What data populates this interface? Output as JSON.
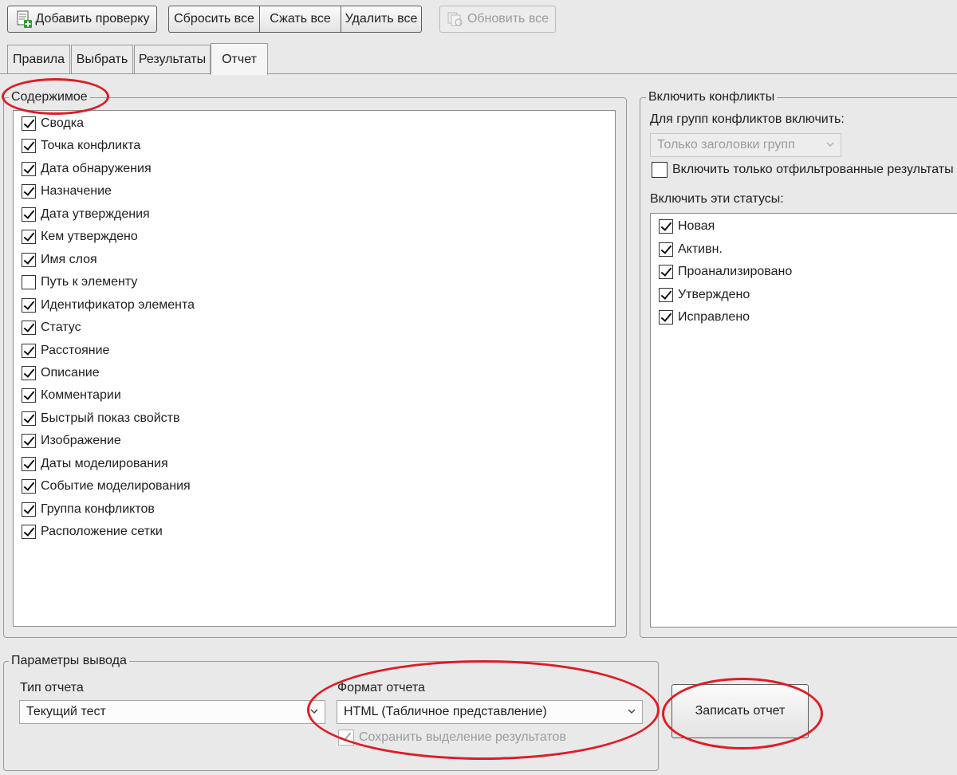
{
  "toolbar": {
    "add_check": "Добавить проверку",
    "reset_all": "Сбросить все",
    "compact_all": "Сжать все",
    "delete_all": "Удалить все",
    "update_all": "Обновить все"
  },
  "tabs": [
    {
      "label": "Правила"
    },
    {
      "label": "Выбрать"
    },
    {
      "label": "Результаты"
    },
    {
      "label": "Отчет",
      "active": true
    }
  ],
  "contents": {
    "title": "Содержимое",
    "items": [
      {
        "label": "Сводка",
        "checked": true
      },
      {
        "label": "Точка конфликта",
        "checked": true
      },
      {
        "label": "Дата обнаружения",
        "checked": true
      },
      {
        "label": "Назначение",
        "checked": true
      },
      {
        "label": "Дата утверждения",
        "checked": true
      },
      {
        "label": "Кем утверждено",
        "checked": true
      },
      {
        "label": "Имя слоя",
        "checked": true
      },
      {
        "label": "Путь к элементу",
        "checked": false
      },
      {
        "label": "Идентификатор элемента",
        "checked": true
      },
      {
        "label": "Статус",
        "checked": true
      },
      {
        "label": "Расстояние",
        "checked": true
      },
      {
        "label": "Описание",
        "checked": true
      },
      {
        "label": "Комментарии",
        "checked": true
      },
      {
        "label": "Быстрый показ свойств",
        "checked": true
      },
      {
        "label": "Изображение",
        "checked": true
      },
      {
        "label": "Даты моделирования",
        "checked": true
      },
      {
        "label": "Событие моделирования",
        "checked": true
      },
      {
        "label": "Группа конфликтов",
        "checked": true
      },
      {
        "label": "Расположение сетки",
        "checked": true
      }
    ]
  },
  "conflicts": {
    "title": "Включить конфликты",
    "groups_label": "Для групп конфликтов включить:",
    "groups_value": "Только заголовки групп",
    "filtered_only_label": "Включить только отфильтрованные результаты",
    "filtered_only_checked": false,
    "statuses_label": "Включить эти статусы:",
    "statuses": [
      {
        "label": "Новая",
        "checked": true
      },
      {
        "label": "Активн.",
        "checked": true
      },
      {
        "label": "Проанализировано",
        "checked": true
      },
      {
        "label": "Утверждено",
        "checked": true
      },
      {
        "label": "Исправлено",
        "checked": true
      }
    ]
  },
  "output": {
    "title": "Параметры вывода",
    "report_type_label": "Тип отчета",
    "report_type_value": "Текущий тест",
    "report_format_label": "Формат отчета",
    "report_format_value": "HTML (Табличное представление)",
    "keep_selection_label": "Сохранить выделение результатов",
    "keep_selection_checked": true,
    "write_report": "Записать отчет"
  },
  "colors": {
    "annotation": "#e01b24",
    "window_bg": "#e9e9e9"
  }
}
